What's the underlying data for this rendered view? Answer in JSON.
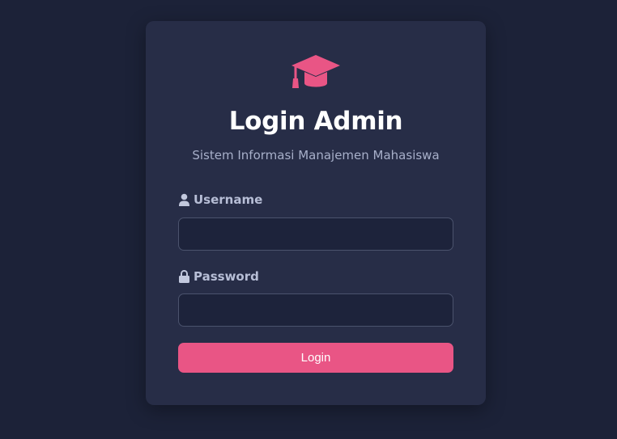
{
  "login": {
    "title": "Login Admin",
    "subtitle": "Sistem Informasi Manajemen Mahasiswa",
    "username_label": "Username",
    "username_value": "",
    "password_label": "Password",
    "password_value": "",
    "button_label": "Login"
  },
  "icons": {
    "logo": "graduation-cap-icon",
    "username": "user-icon",
    "password": "lock-icon"
  },
  "colors": {
    "background": "#1c2238",
    "card": "#272d47",
    "accent": "#e95585",
    "input_background": "#1d233b"
  }
}
